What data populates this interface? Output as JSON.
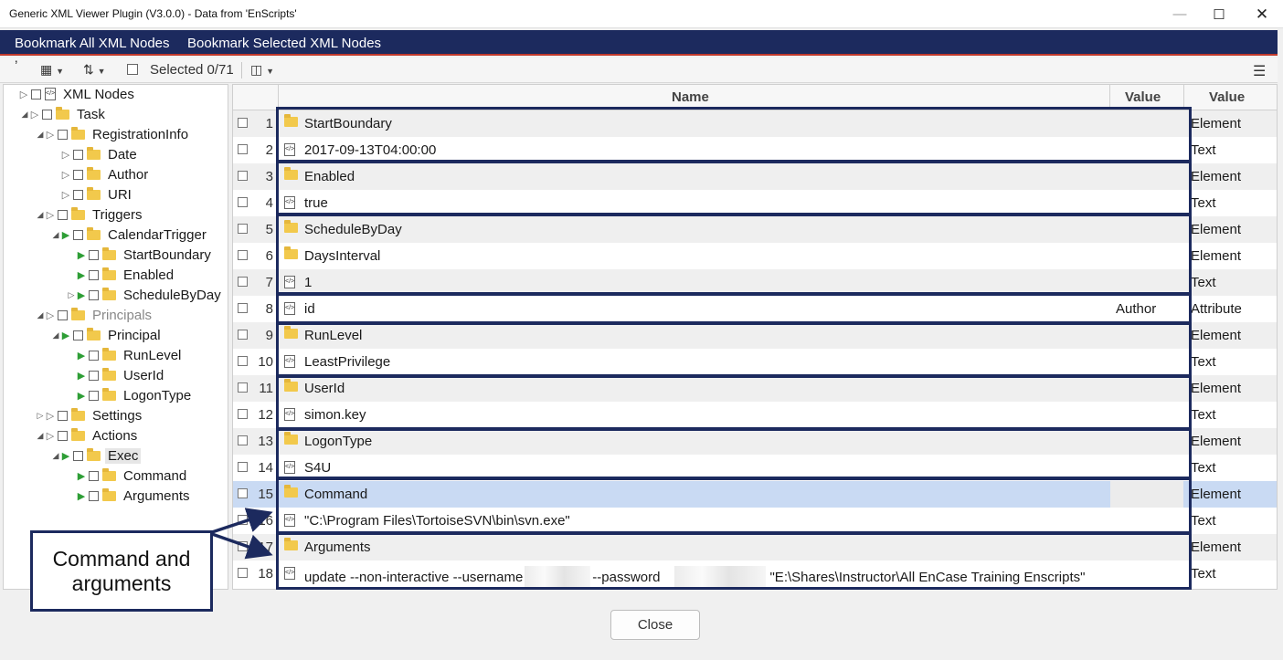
{
  "window": {
    "title": "Generic XML Viewer Plugin (V3.0.0) - Data from 'EnScripts'",
    "min_icon": "minimize-icon",
    "max_icon": "maximize-icon",
    "close_icon": "close-icon"
  },
  "menu": {
    "bookmark_all": "Bookmark All XML Nodes",
    "bookmark_selected": "Bookmark Selected XML Nodes"
  },
  "toolbar": {
    "selected_label": "Selected 0/71"
  },
  "tree": [
    {
      "label": "XML Nodes",
      "icon": "file"
    },
    {
      "label": "Task",
      "icon": "folder"
    },
    {
      "label": "RegistrationInfo",
      "icon": "folder"
    },
    {
      "label": "Date",
      "icon": "folder"
    },
    {
      "label": "Author",
      "icon": "folder"
    },
    {
      "label": "URI",
      "icon": "folder"
    },
    {
      "label": "Triggers",
      "icon": "folder"
    },
    {
      "label": "CalendarTrigger",
      "icon": "folder"
    },
    {
      "label": "StartBoundary",
      "icon": "folder"
    },
    {
      "label": "Enabled",
      "icon": "folder"
    },
    {
      "label": "ScheduleByDay",
      "icon": "folder"
    },
    {
      "label": "Principals",
      "icon": "folder"
    },
    {
      "label": "Principal",
      "icon": "folder"
    },
    {
      "label": "RunLevel",
      "icon": "folder"
    },
    {
      "label": "UserId",
      "icon": "folder"
    },
    {
      "label": "LogonType",
      "icon": "folder"
    },
    {
      "label": "Settings",
      "icon": "folder"
    },
    {
      "label": "Actions",
      "icon": "folder"
    },
    {
      "label": "Exec",
      "icon": "folder"
    },
    {
      "label": "Command",
      "icon": "folder"
    },
    {
      "label": "Arguments",
      "icon": "folder"
    }
  ],
  "grid": {
    "headers": {
      "name": "Name",
      "value": "Value",
      "type": "Value"
    },
    "rows": [
      {
        "num": "1",
        "icon": "folder",
        "name": "StartBoundary",
        "value": "",
        "type": "Element"
      },
      {
        "num": "2",
        "icon": "file",
        "name": "2017-09-13T04:00:00",
        "value": "",
        "type": "Text"
      },
      {
        "num": "3",
        "icon": "folder",
        "name": "Enabled",
        "value": "",
        "type": "Element"
      },
      {
        "num": "4",
        "icon": "file",
        "name": "true",
        "value": "",
        "type": "Text"
      },
      {
        "num": "5",
        "icon": "folder",
        "name": "ScheduleByDay",
        "value": "",
        "type": "Element"
      },
      {
        "num": "6",
        "icon": "folder",
        "name": "DaysInterval",
        "value": "",
        "type": "Element"
      },
      {
        "num": "7",
        "icon": "file",
        "name": "1",
        "value": "",
        "type": "Text"
      },
      {
        "num": "8",
        "icon": "file",
        "name": "id",
        "value": "Author",
        "type": "Attribute"
      },
      {
        "num": "9",
        "icon": "folder",
        "name": "RunLevel",
        "value": "",
        "type": "Element"
      },
      {
        "num": "10",
        "icon": "file",
        "name": "LeastPrivilege",
        "value": "",
        "type": "Text"
      },
      {
        "num": "11",
        "icon": "folder",
        "name": "UserId",
        "value": "",
        "type": "Element"
      },
      {
        "num": "12",
        "icon": "file",
        "name": "simon.key",
        "value": "",
        "type": "Text"
      },
      {
        "num": "13",
        "icon": "folder",
        "name": "LogonType",
        "value": "",
        "type": "Element"
      },
      {
        "num": "14",
        "icon": "file",
        "name": "S4U",
        "value": "",
        "type": "Text"
      },
      {
        "num": "15",
        "icon": "folder",
        "name": "Command",
        "value": "",
        "type": "Element"
      },
      {
        "num": "16",
        "icon": "file",
        "name": "\"C:\\Program Files\\TortoiseSVN\\bin\\svn.exe\"",
        "value": "",
        "type": "Text"
      },
      {
        "num": "17",
        "icon": "folder",
        "name": "Arguments",
        "value": "",
        "type": "Element"
      },
      {
        "num": "18",
        "icon": "file",
        "name": "",
        "value": "",
        "type": "Text"
      }
    ],
    "row18_parts": {
      "p1": "update --non-interactive --username",
      "p2": "--password",
      "p3": "\"E:\\Shares\\Instructor\\All EnCase Training Enscripts\""
    }
  },
  "callout": {
    "line1": "Command and",
    "line2": "arguments"
  },
  "footer": {
    "close_label": "Close"
  },
  "colors": {
    "navy": "#1c2a5e",
    "accent_red": "#c0392b",
    "selection": "#c9daf3",
    "folder": "#f2c94c",
    "expand_green": "#2e9e36"
  }
}
